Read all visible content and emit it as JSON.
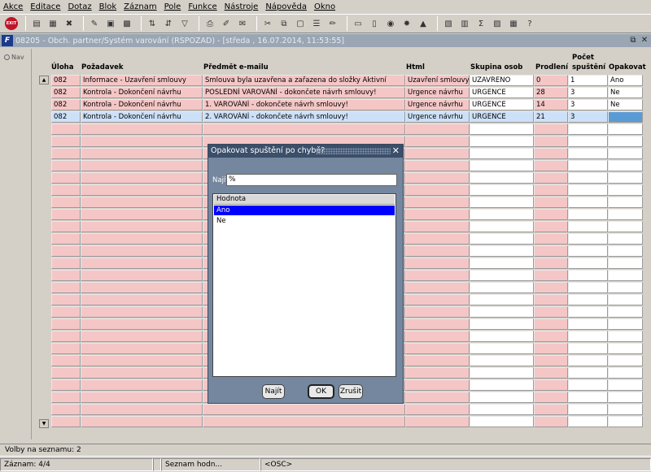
{
  "menu": {
    "items": [
      "Akce",
      "Editace",
      "Dotaz",
      "Blok",
      "Záznam",
      "Pole",
      "Funkce",
      "Nástroje",
      "Nápověda",
      "Okno"
    ]
  },
  "toolbar": {
    "exit_label": "EXIT"
  },
  "window": {
    "title": "08205 - Obch. partner/Systém varování (RSPOZAD) - [středa , 16.07.2014, 11:53:55]",
    "restore_glyph": "⧉",
    "close_glyph": "✕"
  },
  "nav": {
    "label": "Nav"
  },
  "table": {
    "headers": {
      "uloha": "Úloha",
      "pozadavek": "Požadavek",
      "predmet": "Předmět e-mailu",
      "html": "Html",
      "skupina": "Skupina osob",
      "prodleni": "Prodlení",
      "pocet_line1": "Počet",
      "pocet_line2": "spuštění",
      "opakovat": "Opakovat"
    },
    "rows": [
      {
        "uloha": "082",
        "pozadavek": "Informace - Uzavření smlouvy",
        "predmet": "Smlouva byla uzavřena a zařazena do složky Aktivní",
        "html": "Uzavření smlouvy",
        "skupina": "UZAVRENO",
        "prodleni": "0",
        "pocet": "1",
        "opakovat": "Ano"
      },
      {
        "uloha": "082",
        "pozadavek": "Kontrola - Dokončení návrhu",
        "predmet": "POSLEDNÍ VAROVÁNÍ - dokončete návrh smlouvy!",
        "html": "Urgence návrhu",
        "skupina": "URGENCE",
        "prodleni": "28",
        "pocet": "3",
        "opakovat": "Ne"
      },
      {
        "uloha": "082",
        "pozadavek": "Kontrola - Dokončení návrhu",
        "predmet": "1. VAROVÁNÍ - dokončete návrh smlouvy!",
        "html": "Urgence návrhu",
        "skupina": "URGENCE",
        "prodleni": "14",
        "pocet": "3",
        "opakovat": "Ne"
      },
      {
        "uloha": "082",
        "pozadavek": "Kontrola - Dokončení návrhu",
        "predmet": "2. VAROVÁNÍ - dokončete návrh smlouvy!",
        "html": "Urgence návrhu",
        "skupina": "URGENCE",
        "prodleni": "21",
        "pocet": "3",
        "opakovat": ""
      }
    ]
  },
  "dialog": {
    "title": "Opakovat spuštění po chybě?",
    "close_glyph": "✕",
    "search_label": "Najít",
    "search_value": "%",
    "list_header": "Hodnota",
    "options": [
      "Ano",
      "Ne"
    ],
    "selected_option": "Ano",
    "find_button": "Najít",
    "ok_button": "OK",
    "cancel_button": "Zrušit"
  },
  "status": {
    "list_choices": "Volby na seznamu: 2",
    "record": "Záznam: 4/4",
    "list_values": "Seznam hodn...",
    "osc": "<OSC>"
  },
  "colors": {
    "row_pink": "#f5c6c6",
    "row_selected": "#cce0f8",
    "list_selected": "#0000ff",
    "dialog_bg": "#74879e",
    "title_bar": "#9aa6b4"
  }
}
